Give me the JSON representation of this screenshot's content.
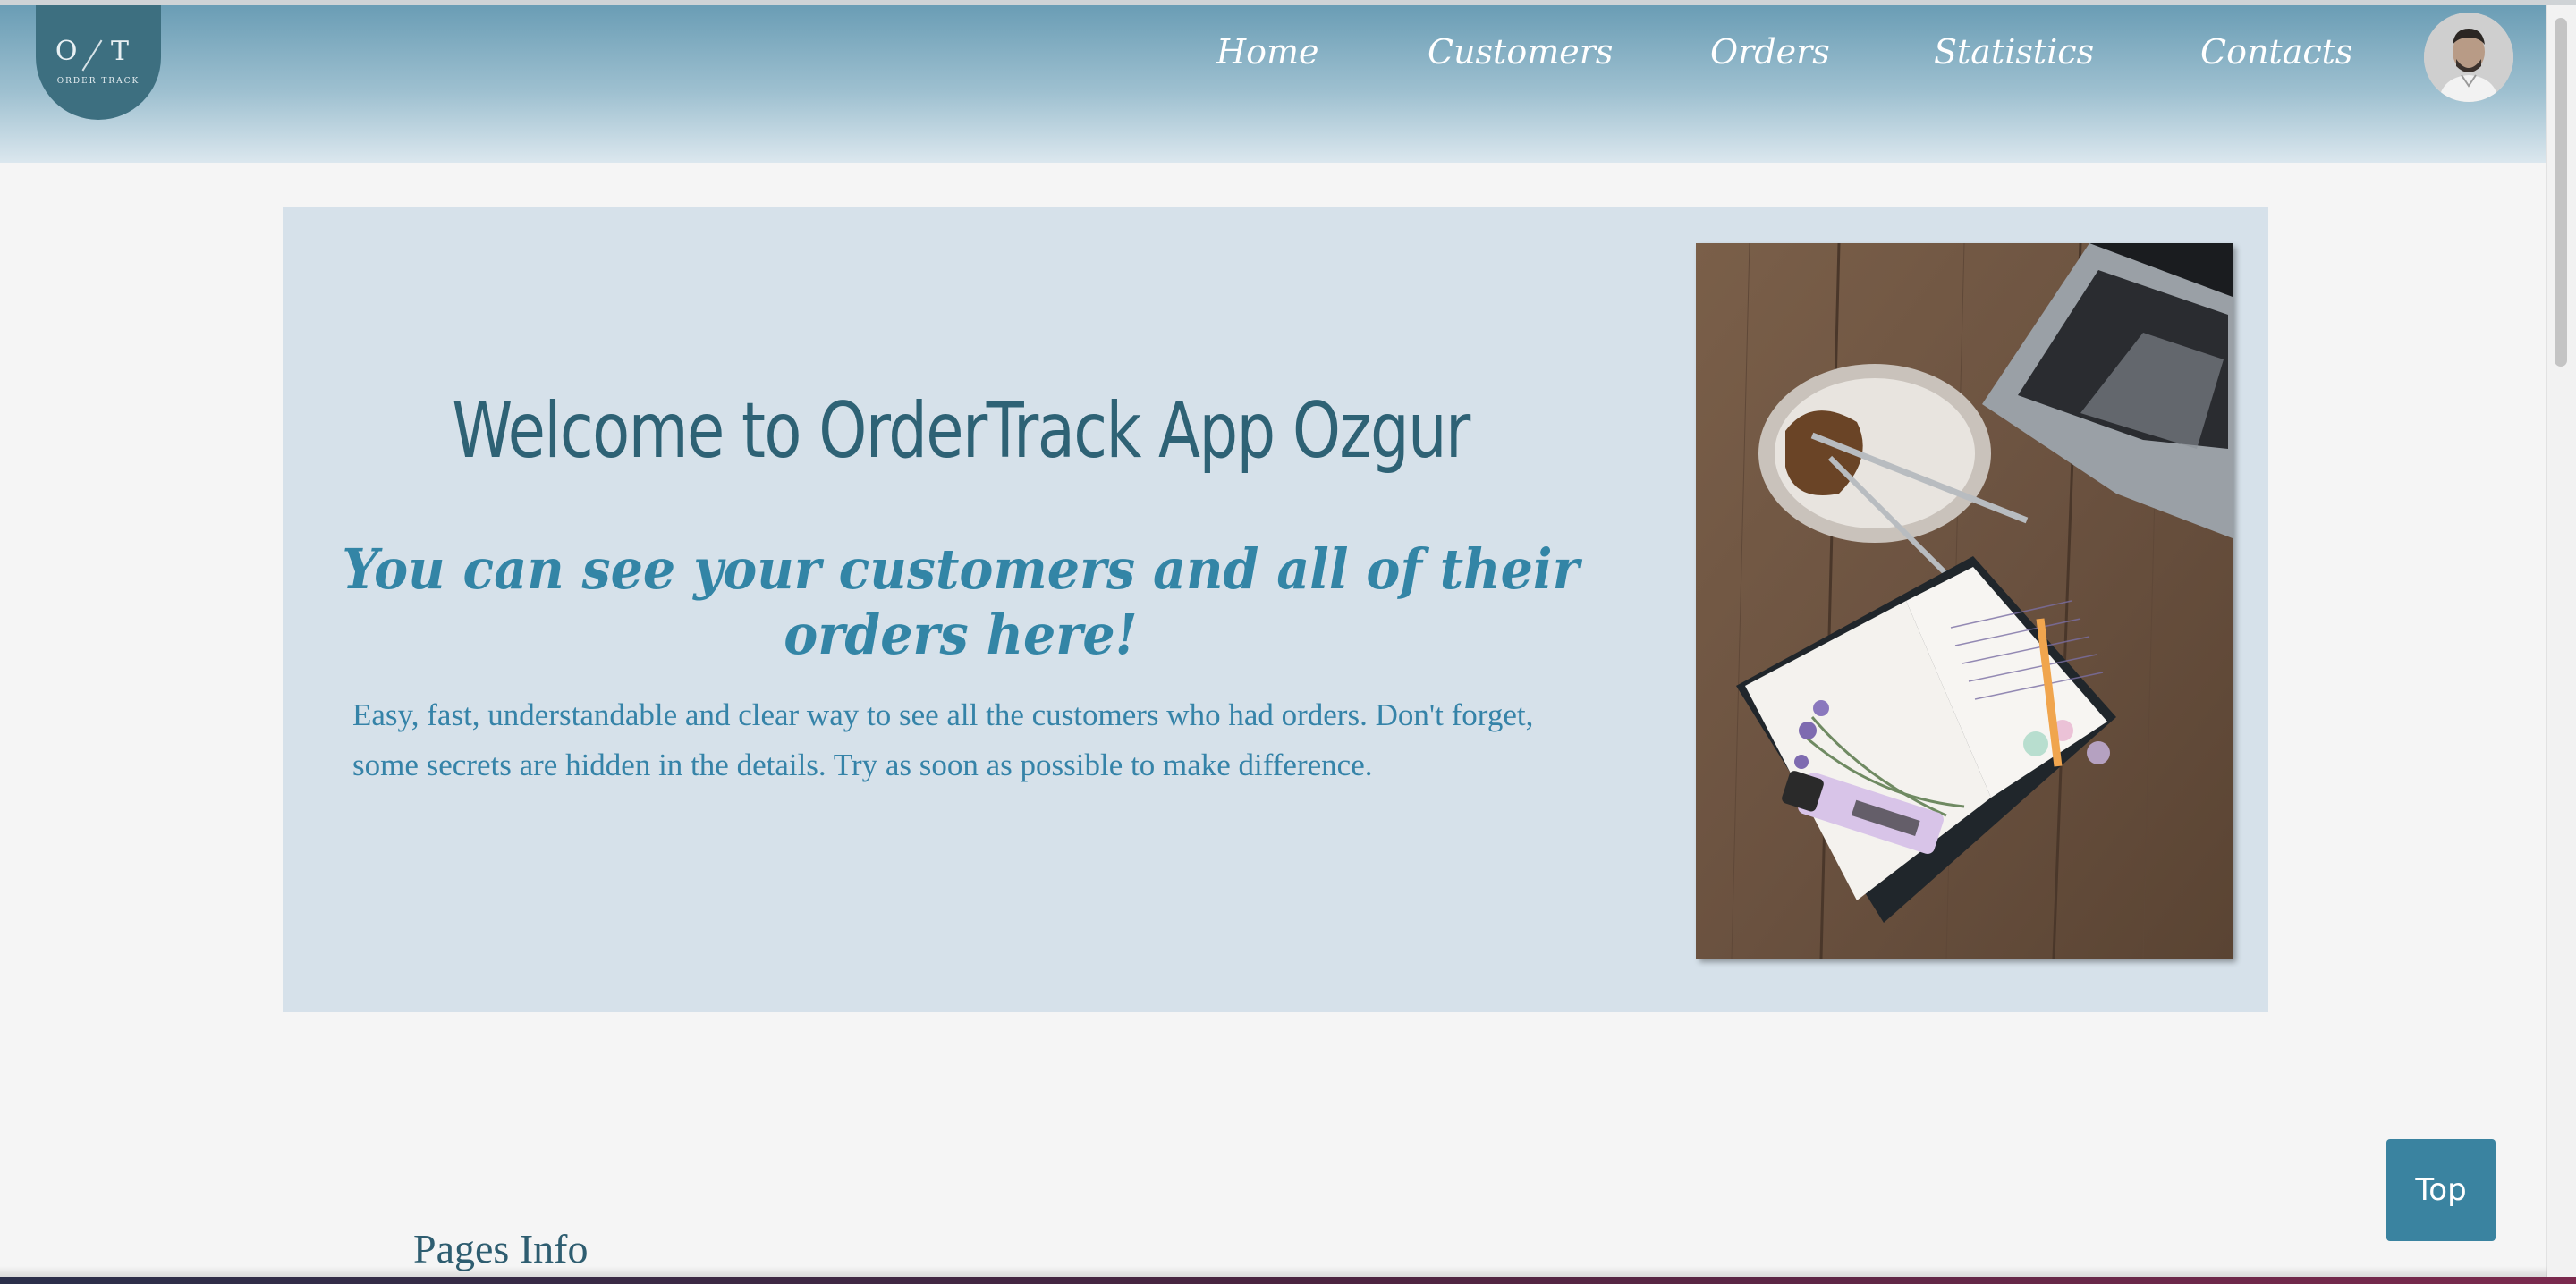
{
  "logo": {
    "monogram": "O T",
    "wordmark": "ORDER TRACK"
  },
  "nav": {
    "home": "Home",
    "customers": "Customers",
    "orders": "Orders",
    "statistics": "Statistics",
    "contacts": "Contacts"
  },
  "hero": {
    "title": "Welcome to OrderTrack App Ozgur",
    "subtitle": "You can see your customers and all of their orders here!",
    "description": "Easy, fast, understandable and clear way to see all the customers who had orders. Don't forget, some secrets are hidden in the details. Try as soon as possible to make difference."
  },
  "top_button": {
    "label": "Top"
  },
  "sections": {
    "pages_info": "Pages Info"
  },
  "colors": {
    "navbar": "#6a9db5",
    "hero_background": "#d6e1ea",
    "title": "#2e6275",
    "accent": "#3a83a0"
  }
}
